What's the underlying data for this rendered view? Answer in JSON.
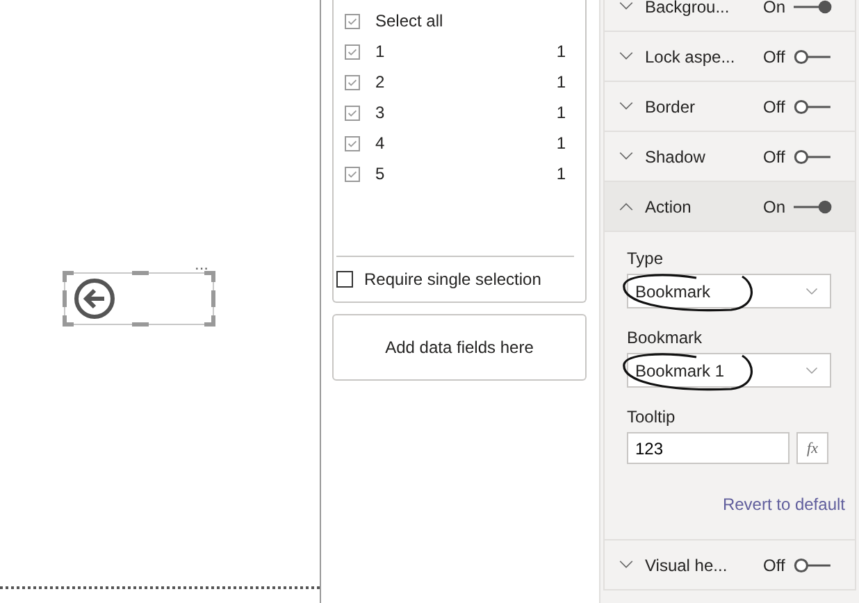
{
  "canvas": {
    "more_options": "..."
  },
  "slicer": {
    "items": [
      {
        "label": "Select all",
        "checked": true
      },
      {
        "label": "1",
        "count": "1",
        "checked": true
      },
      {
        "label": "2",
        "count": "1",
        "checked": true
      },
      {
        "label": "3",
        "count": "1",
        "checked": true
      },
      {
        "label": "4",
        "count": "1",
        "checked": true
      },
      {
        "label": "5",
        "count": "1",
        "checked": true
      }
    ],
    "require_single": {
      "label": "Require single selection",
      "checked": false
    },
    "add_fields": "Add data fields here"
  },
  "format_pane": {
    "sections": [
      {
        "title": "Backgrou...",
        "state": "On",
        "on": true,
        "expanded": false
      },
      {
        "title": "Lock aspe...",
        "state": "Off",
        "on": false,
        "expanded": false
      },
      {
        "title": "Border",
        "state": "Off",
        "on": false,
        "expanded": false
      },
      {
        "title": "Shadow",
        "state": "Off",
        "on": false,
        "expanded": false
      },
      {
        "title": "Action",
        "state": "On",
        "on": true,
        "expanded": true,
        "fields": [
          {
            "kind": "dropdown",
            "label": "Type",
            "value": "Bookmark"
          },
          {
            "kind": "dropdown",
            "label": "Bookmark",
            "value": "Bookmark 1"
          },
          {
            "kind": "text",
            "label": "Tooltip",
            "value": "123",
            "fx": "fx"
          }
        ],
        "revert": "Revert to default"
      },
      {
        "title": "Visual he...",
        "state": "Off",
        "on": false,
        "expanded": false
      }
    ]
  }
}
